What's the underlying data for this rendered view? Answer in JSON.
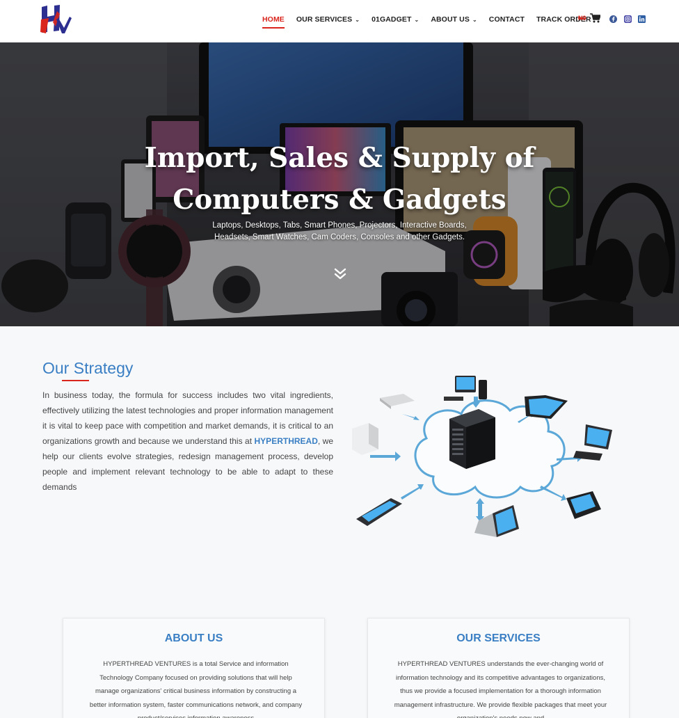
{
  "header": {
    "nav": [
      {
        "label": "HOME",
        "active": true,
        "dropdown": false
      },
      {
        "label": "OUR SERVICES",
        "active": false,
        "dropdown": true
      },
      {
        "label": "01GADGET",
        "active": false,
        "dropdown": true
      },
      {
        "label": "ABOUT US",
        "active": false,
        "dropdown": true
      },
      {
        "label": "CONTACT",
        "active": false,
        "dropdown": false
      },
      {
        "label": "TRACK ORDER",
        "active": false,
        "dropdown": false
      }
    ],
    "cart_amount": "₦0",
    "icons": [
      "cart-icon",
      "facebook-icon",
      "instagram-icon",
      "linkedin-icon"
    ]
  },
  "hero": {
    "title_line1": "Import, Sales & Supply of",
    "title_line2": "Computers & Gadgets",
    "subtitle_line1": "Laptops, Desktops, Tabs, Smart Phones, Projectors, Interactive Boards,",
    "subtitle_line2": "Headsets, Smart Watches, Cam Coders, Consoles and other Gadgets."
  },
  "strategy": {
    "title": "Our Strategy",
    "text_before": "In business today, the formula for success includes two vital ingredients, effectively utilizing the latest technologies and proper information management it is vital to keep pace with competition and market demands, it is critical to an organizations growth and because we understand this at ",
    "highlight": "HYPERTHREAD",
    "text_after": ", we help our clients evolve strategies, redesign management process, develop people and implement relevant technology to be able to adapt to these demands"
  },
  "cards": [
    {
      "title": "ABOUT US",
      "text": "HYPERTHREAD VENTURES is a total Service and information Technology Company focused on providing solutions that will help manage organizations' critical business information by constructing a better information system, faster communications network, and company product/services information awareness"
    },
    {
      "title": "OUR SERVICES",
      "text": "HYPERTHREAD VENTURES understands the ever-changing world of information technology and its competitive advantages to organizations, thus we provide a focused implementation for a thorough information management infrastructure. We provide flexible packages that meet your organization's needs now and"
    }
  ],
  "colors": {
    "accent_red": "#d9251c",
    "accent_blue": "#3a7fc4"
  }
}
